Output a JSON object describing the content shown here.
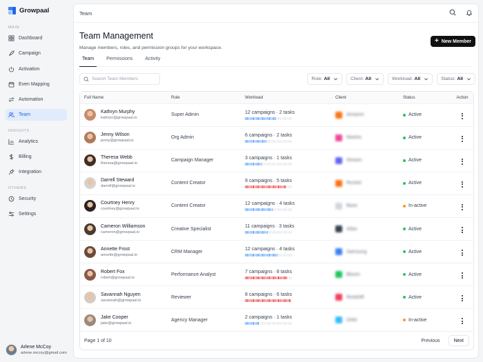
{
  "brand": {
    "name": "Growpaal"
  },
  "sidebar": {
    "sections": {
      "main": "MAIN",
      "insights": "INSIGHTS",
      "others": "OTHERS"
    },
    "main_items": [
      {
        "label": "Dashboard",
        "icon": "grid-icon"
      },
      {
        "label": "Campaign",
        "icon": "rocket-icon"
      },
      {
        "label": "Activation",
        "icon": "power-icon"
      },
      {
        "label": "Even Mapping",
        "icon": "calendar-icon"
      },
      {
        "label": "Automation",
        "icon": "swap-icon"
      },
      {
        "label": "Team",
        "icon": "users-icon",
        "active": true
      }
    ],
    "insights_items": [
      {
        "label": "Analytics",
        "icon": "chart-icon"
      },
      {
        "label": "Billing",
        "icon": "dollar-icon"
      },
      {
        "label": "Integration",
        "icon": "plug-icon"
      }
    ],
    "others_items": [
      {
        "label": "Security",
        "icon": "shield-icon"
      },
      {
        "label": "Settings",
        "icon": "sliders-icon"
      }
    ],
    "user": {
      "name": "Arlene McCoy",
      "email": "arlene.mccoy@gmail.com"
    }
  },
  "topbar": {
    "title": "Team"
  },
  "page": {
    "title": "Team Management",
    "subtitle": "Manage members, roles, and permission groups for your workspace.",
    "new_button": "New Member"
  },
  "tabs": [
    {
      "label": "Team",
      "active": true
    },
    {
      "label": "Permissions"
    },
    {
      "label": "Activity"
    }
  ],
  "search": {
    "placeholder": "Search Team Members"
  },
  "filters": [
    {
      "label": "Role:",
      "value": "All"
    },
    {
      "label": "Client:",
      "value": "All"
    },
    {
      "label": "Workload:",
      "value": "All"
    },
    {
      "label": "Status:",
      "value": "All"
    }
  ],
  "table": {
    "headers": [
      "Full Name",
      "Role",
      "Workload",
      "Client",
      "Status",
      "Action"
    ],
    "rows": [
      {
        "name": "Kathryn Murphy",
        "email": "kathryn@growpaal.io",
        "role": "Super Admin",
        "workload": "12 campaigns · 2 tasks",
        "load": 0.65,
        "bar_color": "#60a5fa",
        "client": "Amazon",
        "client_color": "#f97316",
        "status": "Active",
        "status_color": "#22c55e",
        "avatar_color": "#c98b6b"
      },
      {
        "name": "Jenny Wilson",
        "email": "jenny@growpaal.io",
        "role": "Org Admin",
        "workload": "6 campaigns · 2 tasks",
        "load": 0.45,
        "bar_color": "#60a5fa",
        "client": "Mantra",
        "client_color": "#ec4899",
        "status": "Active",
        "status_color": "#22c55e",
        "avatar_color": "#b07a5a"
      },
      {
        "name": "Theresa Webb",
        "email": "theresa@growpaal.io",
        "role": "Campaign Manager",
        "workload": "3 campaigns · 1 tasks",
        "load": 0.35,
        "bar_color": "#60a5fa",
        "client": "Stream",
        "client_color": "#6366f1",
        "status": "Active",
        "status_color": "#22c55e",
        "avatar_color": "#3f2e26"
      },
      {
        "name": "Darrell Steward",
        "email": "darrell@growpaal.io",
        "role": "Content Creator",
        "workload": "9 campaigns · 5 tasks",
        "load": 0.85,
        "bar_color": "#ef4444",
        "client": "Rocket",
        "client_color": "#f97316",
        "status": "Active",
        "status_color": "#22c55e",
        "avatar_color": "#d8d2cc"
      },
      {
        "name": "Courtney Henry",
        "email": "courtney@growpaal.io",
        "role": "Content Creator",
        "workload": "12 campaigns · 4 tasks",
        "load": 0.6,
        "bar_color": "#60a5fa",
        "client": "Base",
        "client_color": "#d1d5db",
        "status": "In-active",
        "status_color": "#f59e0b",
        "avatar_color": "#2d2220"
      },
      {
        "name": "Cameron Williamson",
        "email": "cameron@growpaal.io",
        "role": "Creative Specialist",
        "workload": "11 campaigns · 3 tasks",
        "load": 0.5,
        "bar_color": "#60a5fa",
        "client": "Atlas",
        "client_color": "#374151",
        "status": "Active",
        "status_color": "#22c55e",
        "avatar_color": "#4a3a30"
      },
      {
        "name": "Annette Frost",
        "email": "annette@growpaal.io",
        "role": "CRM Manager",
        "workload": "12 campaigns · 4 tasks",
        "load": 0.7,
        "bar_color": "#60a5fa",
        "client": "Samsung",
        "client_color": "#3b82f6",
        "status": "Active",
        "status_color": "#22c55e",
        "avatar_color": "#6b4a3c"
      },
      {
        "name": "Robert Fox",
        "email": "robert@growpaal.io",
        "role": "Performance Analyst",
        "workload": "7 campaigns · 8 tasks",
        "load": 0.9,
        "bar_color": "#ef4444",
        "client": "Bloom",
        "client_color": "#22c55e",
        "status": "Active",
        "status_color": "#22c55e",
        "avatar_color": "#8a5a4a"
      },
      {
        "name": "Savannah Nguyen",
        "email": "savannah@growpaal.io",
        "role": "Reviewer",
        "workload": "8 campaigns · 6 tasks",
        "load": 0.95,
        "bar_color": "#ef4444",
        "client": "Redshift",
        "client_color": "#f43f5e",
        "status": "Active",
        "status_color": "#22c55e",
        "avatar_color": "#d6ccc4"
      },
      {
        "name": "Jake Cooper",
        "email": "jake@growpaal.io",
        "role": "Agency Manager",
        "workload": "2 campaigns · 1 tasks",
        "load": 0.3,
        "bar_color": "#60a5fa",
        "client": "Orbit",
        "client_color": "#38bdf8",
        "status": "In-active",
        "status_color": "#f59e0b",
        "avatar_color": "#9a8a7e"
      }
    ]
  },
  "pager": {
    "info": "Page 1 of 10",
    "prev": "Previous",
    "next": "Next"
  }
}
